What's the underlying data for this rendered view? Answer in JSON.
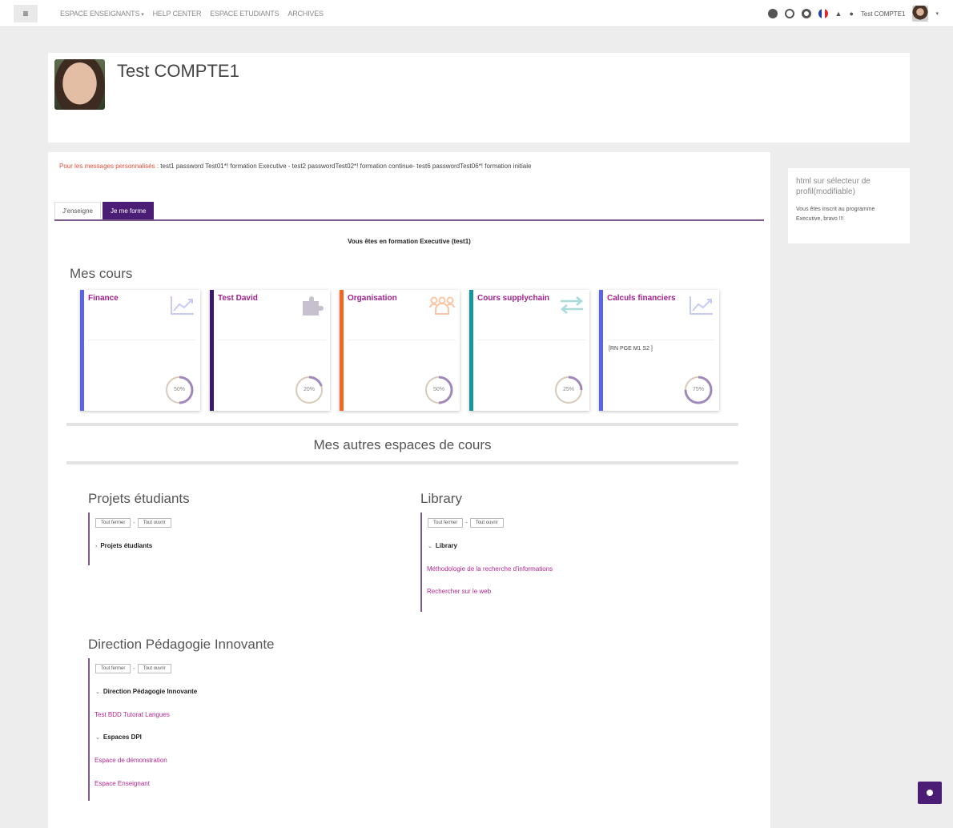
{
  "topbar": {
    "menu_icon": "menu-icon",
    "nav": [
      {
        "label": "ESPACE ENSEIGNANTS",
        "has_caret": true
      },
      {
        "label": "HELP CENTER"
      },
      {
        "label": "ESPACE ETUDIANTS"
      },
      {
        "label": "ARCHIVES"
      }
    ],
    "user_name": "Test COMPTE1"
  },
  "profile": {
    "name": "Test COMPTE1"
  },
  "notice": {
    "label": "Pour les messages personnalisés :",
    "text": " test1 password Test01*! formation Executive - test2  passwordTest02*! formation continue- test6  passwordTest06*!   formation initiale"
  },
  "tabs": [
    {
      "label": "J'enseigne",
      "active": false
    },
    {
      "label": "Je me forme",
      "active": true
    }
  ],
  "formation_text": "Vous êtes en formation Executive (test1)",
  "mes_cours": {
    "title": "Mes cours",
    "cards": [
      {
        "title": "Finance",
        "icon": "chart-line-icon",
        "border": "#5a64e8",
        "icon_color": "#c7cbf3",
        "progress": 50,
        "progress_label": "50%",
        "extra": ""
      },
      {
        "title": "Test David",
        "icon": "puzzle-icon",
        "border": "#3b1a6e",
        "icon_color": "#c6c0cf",
        "progress": 20,
        "progress_label": "20%",
        "extra": ""
      },
      {
        "title": "Organisation",
        "icon": "people-icon",
        "border": "#f26522",
        "icon_color": "#f8c6a7",
        "progress": 50,
        "progress_label": "50%",
        "extra": ""
      },
      {
        "title": "Cours supplychain",
        "icon": "arrows-exchange-icon",
        "border": "#13979d",
        "icon_color": "#a9dbdd",
        "progress": 25,
        "progress_label": "25%",
        "extra": ""
      },
      {
        "title": "Calculs financiers",
        "icon": "chart-line-icon",
        "border": "#5a64e8",
        "icon_color": "#c7cbf3",
        "progress": 75,
        "progress_label": "75%",
        "extra": "[RN PGE M1 S2 ]"
      }
    ]
  },
  "autres_title": "Mes autres espaces de cours",
  "blocks": {
    "projets": {
      "title": "Projets étudiants",
      "btn_close": "Tout fermer",
      "btn_open": "Tout ouvrir",
      "dash": "-",
      "category": "Projets étudiants",
      "chev": "›"
    },
    "library": {
      "title": "Library",
      "btn_close": "Tout fermer",
      "btn_open": "Tout ouvrir",
      "dash": "-",
      "category": "Library",
      "chev": "⌄",
      "links": [
        "Méthodologie de la recherche d'informations",
        "Rechercher sur le web"
      ]
    },
    "dpi": {
      "title": "Direction Pédagogie Innovante",
      "btn_close": "Tout fermer",
      "btn_open": "Tout ouvrir",
      "dash": "-",
      "category1": "Direction Pédagogie Innovante",
      "link1": "Test BDD Tutorat Langues",
      "category2": "Espaces DPI",
      "chev": "⌄",
      "link2": "Espace de démonstration",
      "link3": "Espace Enseignant"
    }
  },
  "sidebar": {
    "title": "html sur sélecteur de profil(modifiable)",
    "text": "Vous êtes inscrit au programme Executive, bravo !!!"
  },
  "colors": {
    "accent": "#4b1d74",
    "link": "#b3288f",
    "ring": "#9f88b9"
  }
}
